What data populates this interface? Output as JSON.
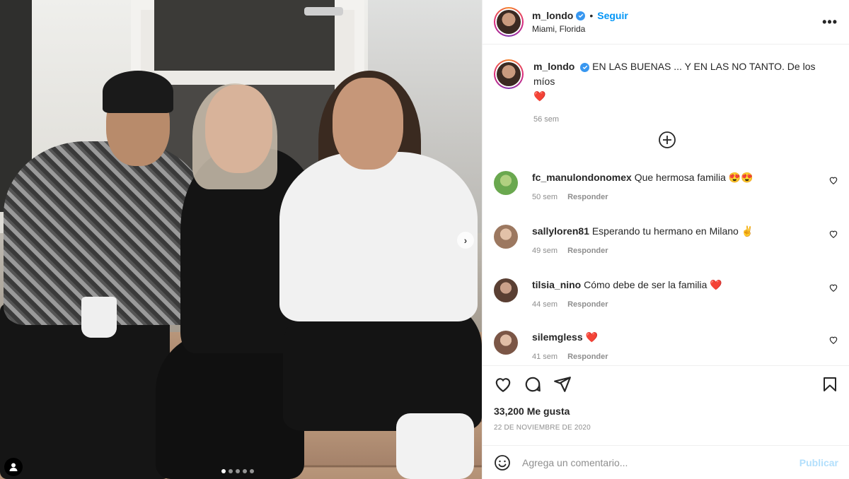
{
  "post": {
    "username": "m_londo",
    "follow_label": "Seguir",
    "bullet": "•",
    "location": "Miami, Florida",
    "more_label": "•••"
  },
  "caption": {
    "username": "m_londo",
    "text": "EN LAS BUENAS ... Y EN LAS NO TANTO. De los míos",
    "emoji": "❤️",
    "time": "56 sem"
  },
  "comments": [
    {
      "username": "fc_manulondonomex",
      "text": "Que hermosa familia",
      "emoji": "😍😍",
      "time": "50 sem",
      "reply_label": "Responder",
      "avatar_color": "#6aa84f"
    },
    {
      "username": "sallyloren81",
      "text": "Esperando tu hermano en Milano",
      "emoji": "✌️",
      "time": "49 sem",
      "reply_label": "Responder",
      "avatar_color": "#c8a082"
    },
    {
      "username": "tilsia_nino",
      "text": "Cómo debe de ser la familia",
      "emoji": "❤️",
      "time": "44 sem",
      "reply_label": "Responder",
      "avatar_color": "#8b6a59"
    },
    {
      "username": "silemgless",
      "text": "",
      "emoji": "❤️",
      "time": "41 sem",
      "reply_label": "Responder",
      "avatar_color": "#b48a78"
    }
  ],
  "actions": {
    "likes": "33,200 Me gusta",
    "date": "22 DE NOVIEMBRE DE 2020"
  },
  "add_comment": {
    "placeholder": "Agrega un comentario...",
    "publish_label": "Publicar"
  },
  "carousel": {
    "total_slides": 5,
    "active_index": 0
  }
}
